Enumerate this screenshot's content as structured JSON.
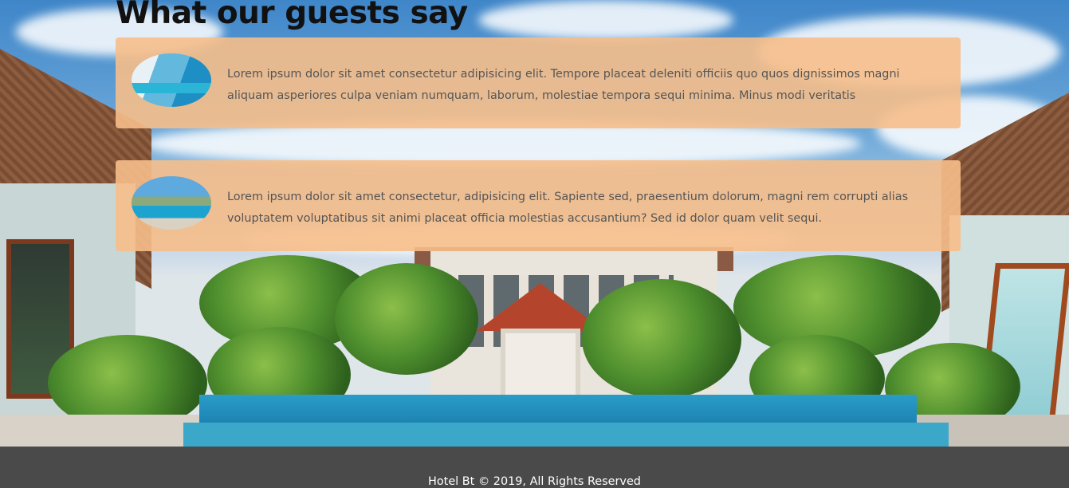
{
  "section": {
    "title": "What our guests say"
  },
  "testimonials": [
    {
      "image": "infinity-pool-ocean-photo",
      "text": "Lorem ipsum dolor sit amet consectetur adipisicing elit. Tempore placeat deleniti officiis quo quos dignissimos magni aliquam asperiores culpa veniam numquam, laborum, molestiae tempora sequi minima. Minus modi veritatis"
    },
    {
      "image": "resort-pool-photo",
      "text": "Lorem ipsum dolor sit amet consectetur, adipisicing elit. Sapiente sed, praesentium dolorum, magni rem corrupti alias voluptatem voluptatibus sit animi placeat officia molestias accusantium? Sed id dolor quam velit sequi."
    }
  ],
  "footer": {
    "copyright": "Hotel Bt © 2019, All Rights Reserved"
  },
  "colors": {
    "card_background": "#f6be8a",
    "footer_background": "#4a4a4a",
    "heading": "#111111",
    "quote_text": "#555555"
  }
}
